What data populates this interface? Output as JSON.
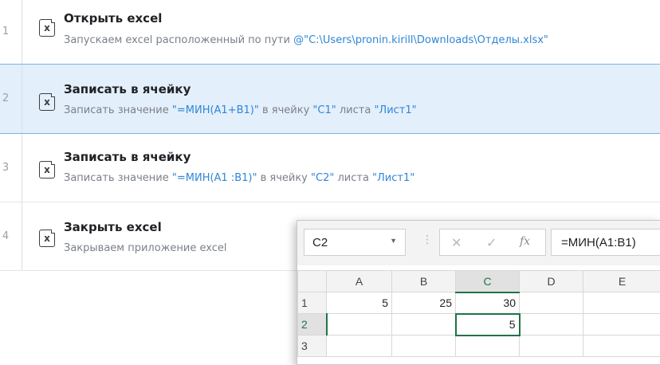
{
  "steps": [
    {
      "num": "1",
      "title": "Открыть excel",
      "desc_prefix": "Запускаем excel расположенный по пути ",
      "desc_hl1": "@\"C:\\Users\\pronin.kirill\\Downloads\\Отделы.xlsx\"",
      "desc_mid": "",
      "desc_hl2": "",
      "desc_mid2": "",
      "desc_hl3": ""
    },
    {
      "num": "2",
      "title": "Записать в ячейку",
      "desc_prefix": "Записать значение ",
      "desc_hl1": "\"=МИН(A1+B1)\"",
      "desc_mid": " в ячейку ",
      "desc_hl2": "\"C1\"",
      "desc_mid2": " листа ",
      "desc_hl3": "\"Лист1\""
    },
    {
      "num": "3",
      "title": "Записать в ячейку",
      "desc_prefix": "Записать значение ",
      "desc_hl1": "\"=МИН(A1 :B1)\"",
      "desc_mid": " в ячейку ",
      "desc_hl2": "\"C2\"",
      "desc_mid2": " листа ",
      "desc_hl3": "\"Лист1\""
    },
    {
      "num": "4",
      "title": "Закрыть excel",
      "desc_prefix": "Закрываем приложение excel",
      "desc_hl1": "",
      "desc_mid": "",
      "desc_hl2": "",
      "desc_mid2": "",
      "desc_hl3": ""
    }
  ],
  "step_icon_glyph": "x",
  "selected_step": 2,
  "excel": {
    "name_box": "C2",
    "name_box_arrow": "▼",
    "separator": "⋮",
    "cancel_glyph": "✕",
    "enter_glyph": "✓",
    "fx_glyph": "fx",
    "formula": "=МИН(A1:B1)",
    "columns": [
      "A",
      "B",
      "C",
      "D",
      "E"
    ],
    "active_column": "C",
    "rows": [
      {
        "header": "1",
        "cells": [
          "5",
          "25",
          "30",
          "",
          ""
        ]
      },
      {
        "header": "2",
        "cells": [
          "",
          "",
          "5",
          "",
          ""
        ]
      },
      {
        "header": "3",
        "cells": [
          "",
          "",
          "",
          "",
          ""
        ]
      }
    ],
    "active_row": "2"
  },
  "colors": {
    "highlight": "#2f86d6",
    "selected_row_bg": "#e3effb",
    "excel_green": "#217346"
  }
}
